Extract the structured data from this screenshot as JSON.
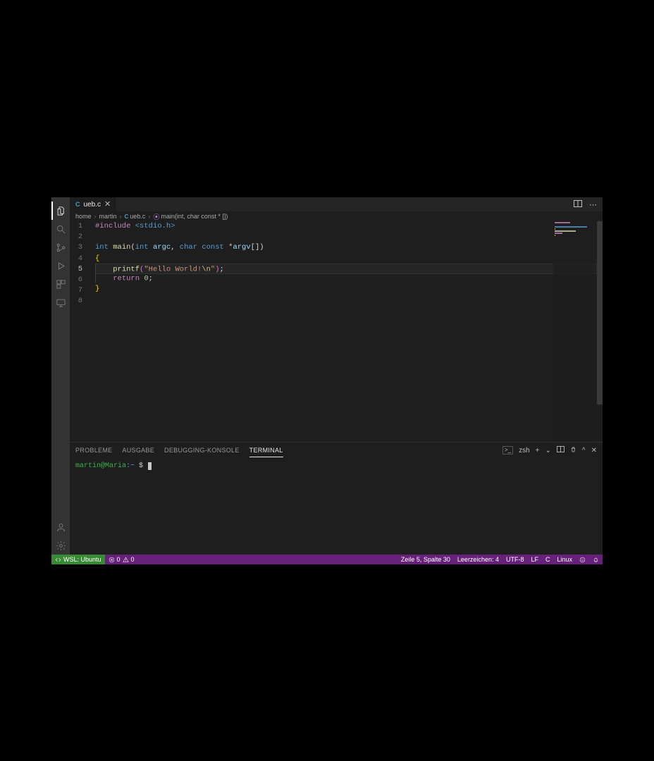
{
  "tab": {
    "filename": "ueb.c",
    "lang_badge": "C"
  },
  "editor_actions": {
    "split": "▯▯",
    "more": "⋯"
  },
  "breadcrumbs": {
    "items": [
      "home",
      "martin",
      "ueb.c"
    ],
    "symbol": "main(int, char const * [])"
  },
  "code": {
    "lines": [
      {
        "n": 1,
        "tokens": [
          [
            "directive",
            "#include"
          ],
          [
            "punct",
            " "
          ],
          [
            "header",
            "<stdio.h>"
          ]
        ]
      },
      {
        "n": 2,
        "tokens": []
      },
      {
        "n": 3,
        "tokens": [
          [
            "type",
            "int"
          ],
          [
            "punct",
            " "
          ],
          [
            "func",
            "main"
          ],
          [
            "punct",
            "("
          ],
          [
            "type",
            "int"
          ],
          [
            "punct",
            " "
          ],
          [
            "param",
            "argc"
          ],
          [
            "punct",
            ", "
          ],
          [
            "type",
            "char"
          ],
          [
            "punct",
            " "
          ],
          [
            "modifier",
            "const"
          ],
          [
            "punct",
            " *"
          ],
          [
            "param",
            "argv"
          ],
          [
            "punct",
            "["
          ],
          [
            "punct",
            "]"
          ],
          [
            "punct",
            ")"
          ]
        ]
      },
      {
        "n": 4,
        "tokens": [
          [
            "brace",
            "{"
          ]
        ]
      },
      {
        "n": 5,
        "current": true,
        "indent": 1,
        "tokens": [
          [
            "func",
            "printf"
          ],
          [
            "paren",
            "("
          ],
          [
            "string",
            "\"Hello World!"
          ],
          [
            "escape",
            "\\n"
          ],
          [
            "string",
            "\""
          ],
          [
            "paren",
            ")"
          ],
          [
            "punct",
            ";"
          ]
        ]
      },
      {
        "n": 6,
        "indent": 1,
        "tokens": [
          [
            "keyword",
            "return"
          ],
          [
            "punct",
            " "
          ],
          [
            "num",
            "0"
          ],
          [
            "punct",
            ";"
          ]
        ]
      },
      {
        "n": 7,
        "tokens": [
          [
            "brace",
            "}"
          ]
        ]
      },
      {
        "n": 8,
        "tokens": []
      }
    ]
  },
  "panel": {
    "tabs": {
      "problems": "PROBLEME",
      "output": "AUSGABE",
      "debug_console": "DEBUGGING-KONSOLE",
      "terminal": "TERMINAL"
    },
    "right": {
      "shell_badge": ">_",
      "shell_name": "zsh",
      "plus": "+",
      "chevron": "⌄",
      "split": "▯▯",
      "trash": "🗑",
      "up": "^",
      "close": "✕"
    },
    "terminal": {
      "user_host": "martin@Maria",
      "path": ":~",
      "prompt": "$"
    }
  },
  "status": {
    "remote_label": "WSL: Ubuntu",
    "errors": "0",
    "warnings": "0",
    "cursor": "Zeile 5, Spalte 30",
    "indent": "Leerzeichen: 4",
    "encoding": "UTF-8",
    "eol": "LF",
    "lang": "C",
    "os": "Linux"
  }
}
